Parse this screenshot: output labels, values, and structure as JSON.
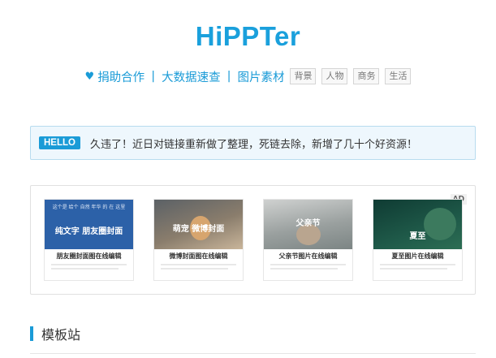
{
  "site": {
    "title": "HiPPTer"
  },
  "nav": {
    "links": [
      "捐助合作",
      "大数据速查",
      "图片素材"
    ],
    "separator": "|",
    "tags": [
      "背景",
      "人物",
      "商务",
      "生活"
    ]
  },
  "notice": {
    "badge": "HELLO",
    "message": "久违了！近日对链接重新做了整理，死链去除，新增了几十个好资源！"
  },
  "ad": {
    "label": "AD",
    "cards": [
      {
        "thumb_title": "纯文字 朋友圈封面",
        "thumb_sub": "这个是 给个 自然 年华 的 在 这里",
        "caption": "朋友圈封面图在线编辑"
      },
      {
        "thumb_title": "萌宠 微博封面",
        "caption": "微博封面图在线编辑"
      },
      {
        "thumb_title": "父亲节",
        "caption": "父亲节图片在线编辑"
      },
      {
        "thumb_title": "夏至",
        "caption": "夏至图片在线编辑"
      }
    ]
  },
  "section": {
    "title": "模板站"
  }
}
